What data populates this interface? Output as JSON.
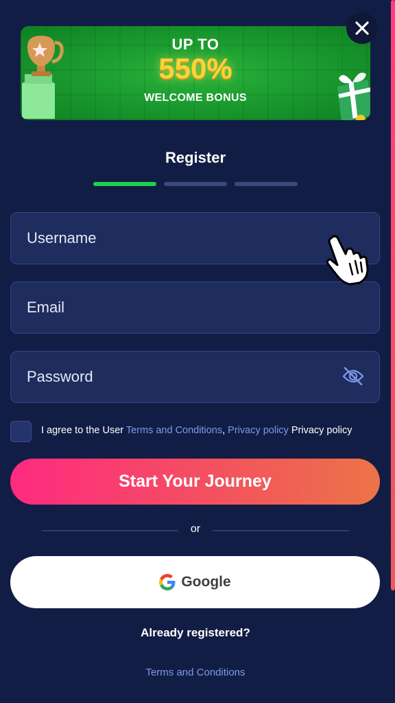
{
  "banner": {
    "line1": "UP TO",
    "amount": "550%",
    "line3": "WELCOME BONUS"
  },
  "title": "Register",
  "steps": {
    "total": 3,
    "active": 1
  },
  "fields": {
    "username_placeholder": "Username",
    "email_placeholder": "Email",
    "password_placeholder": "Password"
  },
  "agreement": {
    "prefix": "I agree to the User ",
    "terms_link": "Terms and Conditions",
    "separator": ", ",
    "privacy_link": "Privacy policy",
    "suffix": " Privacy policy"
  },
  "cta_label": "Start Your Journey",
  "divider_label": "or",
  "google_label": "Google",
  "already_registered": "Already registered?",
  "footer_terms": "Terms and Conditions",
  "colors": {
    "background": "#121d45",
    "field_bg": "#1e2c5e",
    "step_active": "#1fd14a",
    "step_inactive": "#3a4a7c",
    "cta_start": "#ff2a80",
    "cta_end": "#ec7447",
    "link": "#7e9ae8",
    "banner_green": "#1c9a2e",
    "banner_gold": "#ffd23a"
  },
  "icons": [
    "close-icon",
    "eye-off-icon",
    "google-icon",
    "trophy-icon",
    "gift-icon",
    "hand-cursor-icon"
  ]
}
